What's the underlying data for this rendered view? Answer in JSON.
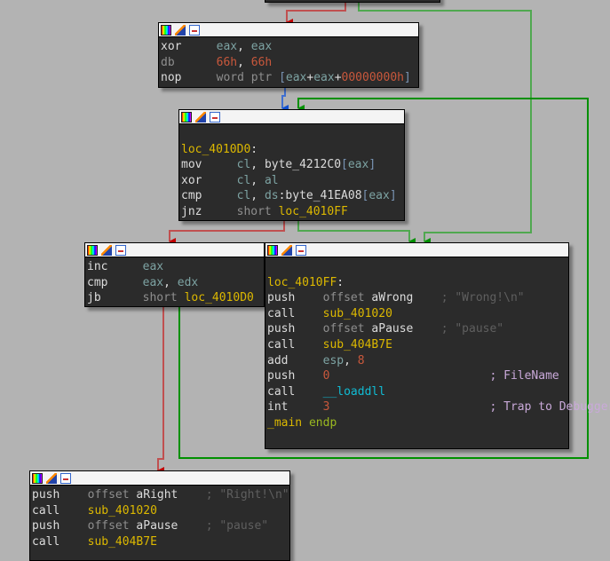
{
  "colors": {
    "true_edge": "#c00000",
    "false_edge": "#009000",
    "flow_edge": "#1050d0",
    "background": "#b3b3b3",
    "node_bg": "#2b2b2b"
  },
  "header_icons": [
    "color-palette-icon",
    "edit-pencil-icon",
    "graph-view-icon"
  ],
  "blocks": [
    {
      "id": "block-top",
      "lines": []
    },
    {
      "id": "block-xor",
      "lines": [
        [
          [
            "xor     ",
            "mnem"
          ],
          [
            "eax",
            "reg"
          ],
          [
            ", ",
            "plain"
          ],
          [
            "eax",
            "reg"
          ]
        ],
        [
          [
            "db      ",
            "mnem-db"
          ],
          [
            "66h",
            "num"
          ],
          [
            ", ",
            "plain"
          ],
          [
            "66h",
            "num"
          ]
        ],
        [
          [
            "nop     ",
            "mnem"
          ],
          [
            "word ptr ",
            "kw"
          ],
          [
            "[",
            "brk"
          ],
          [
            "eax",
            "reg"
          ],
          [
            "+",
            "plain"
          ],
          [
            "eax",
            "reg"
          ],
          [
            "+",
            "plain"
          ],
          [
            "00000000h",
            "num"
          ],
          [
            "]",
            "brk"
          ]
        ]
      ]
    },
    {
      "id": "block-loop",
      "lines": [
        [],
        [
          [
            "loc_4010D0",
            "name"
          ],
          [
            ":",
            "plain"
          ]
        ],
        [
          [
            "mov     ",
            "mnem"
          ],
          [
            "cl",
            "reg"
          ],
          [
            ", ",
            "plain"
          ],
          [
            "byte_4212C0",
            "dname"
          ],
          [
            "[",
            "brk"
          ],
          [
            "eax",
            "reg"
          ],
          [
            "]",
            "brk"
          ]
        ],
        [
          [
            "xor     ",
            "mnem"
          ],
          [
            "cl",
            "reg"
          ],
          [
            ", ",
            "plain"
          ],
          [
            "al",
            "reg"
          ]
        ],
        [
          [
            "cmp     ",
            "mnem"
          ],
          [
            "cl",
            "reg"
          ],
          [
            ", ",
            "plain"
          ],
          [
            "ds",
            "reg"
          ],
          [
            ":",
            "plain"
          ],
          [
            "byte_41EA08",
            "dname"
          ],
          [
            "[",
            "brk"
          ],
          [
            "eax",
            "reg"
          ],
          [
            "]",
            "brk"
          ]
        ],
        [
          [
            "jnz     ",
            "mnem"
          ],
          [
            "short ",
            "kw"
          ],
          [
            "loc_4010FF",
            "name"
          ]
        ]
      ]
    },
    {
      "id": "block-inc",
      "lines": [
        [
          [
            "inc     ",
            "mnem"
          ],
          [
            "eax",
            "reg"
          ]
        ],
        [
          [
            "cmp     ",
            "mnem"
          ],
          [
            "eax",
            "reg"
          ],
          [
            ", ",
            "plain"
          ],
          [
            "edx",
            "reg"
          ]
        ],
        [
          [
            "jb      ",
            "mnem"
          ],
          [
            "short ",
            "kw"
          ],
          [
            "loc_4010D0",
            "name"
          ]
        ]
      ]
    },
    {
      "id": "block-wrong",
      "lines": [
        [],
        [
          [
            "loc_4010FF",
            "name"
          ],
          [
            ":",
            "plain"
          ]
        ],
        [
          [
            "push    ",
            "mnem"
          ],
          [
            "offset ",
            "kw"
          ],
          [
            "aWrong",
            "dname"
          ],
          [
            "    ; \"Wrong!\\n\"",
            "cmt"
          ]
        ],
        [
          [
            "call    ",
            "mnem"
          ],
          [
            "sub_401020",
            "name"
          ]
        ],
        [
          [
            "push    ",
            "mnem"
          ],
          [
            "offset ",
            "kw"
          ],
          [
            "aPause",
            "dname"
          ],
          [
            "    ; \"pause\"",
            "cmt"
          ]
        ],
        [
          [
            "call    ",
            "mnem"
          ],
          [
            "sub_404B7E",
            "name"
          ]
        ],
        [
          [
            "add     ",
            "mnem"
          ],
          [
            "esp",
            "reg"
          ],
          [
            ", ",
            "plain"
          ],
          [
            "8",
            "num"
          ]
        ],
        [
          [
            "push    ",
            "mnem"
          ],
          [
            "0",
            "num"
          ],
          [
            "                       ; FileName",
            "cmt2"
          ]
        ],
        [
          [
            "call    ",
            "mnem"
          ],
          [
            "__loaddll",
            "imp"
          ]
        ],
        [
          [
            "int     ",
            "mnem"
          ],
          [
            "3",
            "num"
          ],
          [
            "                       ; Trap to Debugger",
            "cmt2"
          ]
        ],
        [
          [
            "_main",
            "name"
          ],
          [
            " endp",
            "endp"
          ]
        ]
      ]
    },
    {
      "id": "block-right",
      "lines": [
        [
          [
            "push    ",
            "mnem"
          ],
          [
            "offset ",
            "kw"
          ],
          [
            "aRight",
            "dname"
          ],
          [
            "    ; \"Right!\\n\"",
            "cmt"
          ]
        ],
        [
          [
            "call    ",
            "mnem"
          ],
          [
            "sub_401020",
            "name"
          ]
        ],
        [
          [
            "push    ",
            "mnem"
          ],
          [
            "offset ",
            "kw"
          ],
          [
            "aPause",
            "dname"
          ],
          [
            "    ; \"pause\"",
            "cmt"
          ]
        ],
        [
          [
            "call    ",
            "mnem"
          ],
          [
            "sub_404B7E",
            "name"
          ]
        ]
      ]
    }
  ]
}
